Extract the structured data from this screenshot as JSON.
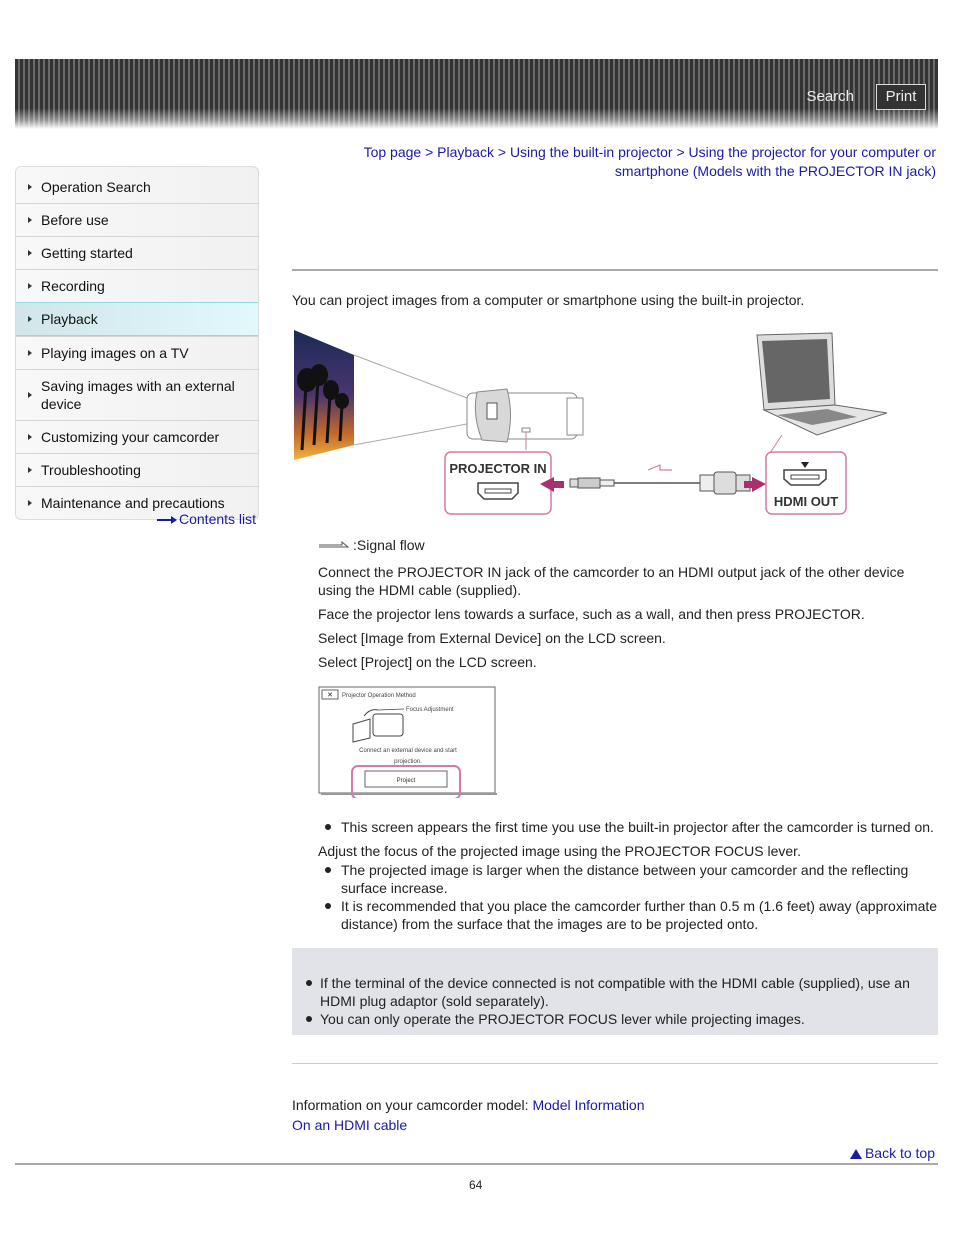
{
  "header": {
    "search_label": "Search",
    "print_label": "Print"
  },
  "sidebar": {
    "items": [
      {
        "label": "Operation Search",
        "active": false
      },
      {
        "label": "Before use",
        "active": false
      },
      {
        "label": "Getting started",
        "active": false
      },
      {
        "label": "Recording",
        "active": false
      },
      {
        "label": "Playback",
        "active": true
      },
      {
        "label": "Playing images on a TV",
        "active": false
      },
      {
        "label": "Saving images with an external device",
        "active": false
      },
      {
        "label": "Customizing your camcorder",
        "active": false
      },
      {
        "label": "Troubleshooting",
        "active": false
      },
      {
        "label": "Maintenance and precautions",
        "active": false
      }
    ],
    "contents_link": "Contents list"
  },
  "breadcrumb": {
    "items": [
      "Top page",
      "Playback",
      "Using the built-in projector",
      "Using the projector for your computer or smartphone (Models with the PROJECTOR IN jack)"
    ],
    "separator": " > "
  },
  "main": {
    "intro": "You can project images from a computer or smartphone using the built-in projector.",
    "diagram": {
      "projector_in_label": "PROJECTOR IN",
      "hdmi_out_label": "HDMI OUT"
    },
    "signal_flow_label": ":Signal flow",
    "steps": [
      "Connect the PROJECTOR IN jack of the camcorder to an HDMI output jack of the other device using the HDMI cable (supplied).",
      "Face the projector lens towards a surface, such as a wall, and then press PROJECTOR.",
      "Select [Image from External Device] on the LCD screen.",
      "Select [Project] on the LCD screen."
    ],
    "lcd_screen": {
      "title": "Projector Operation Method",
      "focus_label": "Focus Adjustment",
      "message_line1": "Connect an external device and start",
      "message_line2": "projection.",
      "button": "Project"
    },
    "step4_note": "This screen appears the first time you use the built-in projector after the camcorder is turned on.",
    "step5": "Adjust the focus of the projected image using the PROJECTOR FOCUS lever.",
    "step5_notes": [
      "The projected image is larger when the distance between your camcorder and the reflecting surface increase.",
      "It is recommended that you place the camcorder further than 0.5 m (1.6 feet) away (approximate distance) from the surface that the images are to be projected onto."
    ],
    "notes": [
      "If the terminal of the device connected is not compatible with the HDMI cable (supplied), use an HDMI plug adaptor (sold separately).",
      "You can only operate the PROJECTOR FOCUS lever while projecting images."
    ],
    "info_prefix": "Information on your camcorder model: ",
    "info_link": "Model Information",
    "related_link": "On an HDMI cable",
    "back_to_top": "Back to top",
    "page_number": "64"
  },
  "colors": {
    "link": "#1a1aa6",
    "highlight_pink": "#d47aa5",
    "arrow_magenta": "#a8306e",
    "note_bg": "#e1e3e8"
  }
}
